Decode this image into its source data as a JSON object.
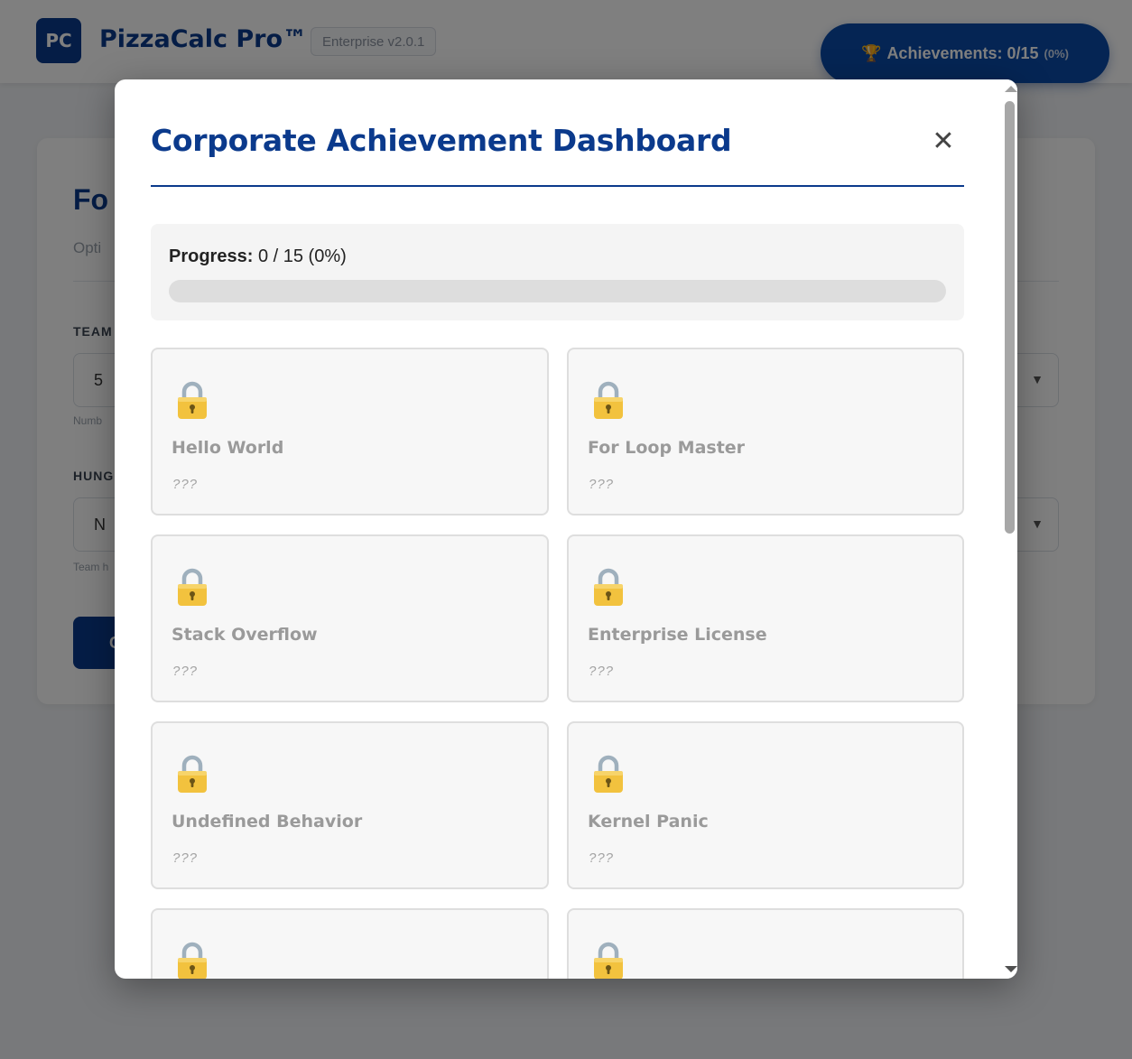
{
  "header": {
    "logo_text": "PC",
    "app_title": "PizzaCalc Pro™",
    "version": "Enterprise v2.0.1",
    "achievements_button": {
      "icon": "trophy-icon",
      "label": "Achievements: 0/15",
      "percent": "(0%)"
    }
  },
  "background_card": {
    "title": "Fo",
    "subtitle": "Opti",
    "fields": [
      {
        "label": "TEAM",
        "value": "5",
        "hint": "Numb"
      },
      {
        "label": "HUNG",
        "value": "N",
        "hint": "Team h"
      }
    ],
    "button_label": "C"
  },
  "modal": {
    "title": "Corporate Achievement Dashboard",
    "close_icon": "close-icon",
    "progress": {
      "label": "Progress:",
      "value": "0 / 15 (0%)",
      "fraction": 0
    },
    "achievements": [
      {
        "name": "Hello World",
        "description": "???",
        "icon": "lock-icon",
        "locked": true
      },
      {
        "name": "For Loop Master",
        "description": "???",
        "icon": "lock-icon",
        "locked": true
      },
      {
        "name": "Stack Overflow",
        "description": "???",
        "icon": "lock-icon",
        "locked": true
      },
      {
        "name": "Enterprise License",
        "description": "???",
        "icon": "lock-icon",
        "locked": true
      },
      {
        "name": "Undefined Behavior",
        "description": "???",
        "icon": "lock-icon",
        "locked": true
      },
      {
        "name": "Kernel Panic",
        "description": "???",
        "icon": "lock-icon",
        "locked": true
      },
      {
        "name": "",
        "description": "",
        "icon": "lock-icon",
        "locked": true
      },
      {
        "name": "",
        "description": "",
        "icon": "lock-icon",
        "locked": true
      }
    ]
  },
  "colors": {
    "brand": "#0b3a8c",
    "locked_text": "#9a9a9a",
    "card_bg": "#f7f7f7",
    "overlay": "rgba(0,0,0,0.5)"
  }
}
